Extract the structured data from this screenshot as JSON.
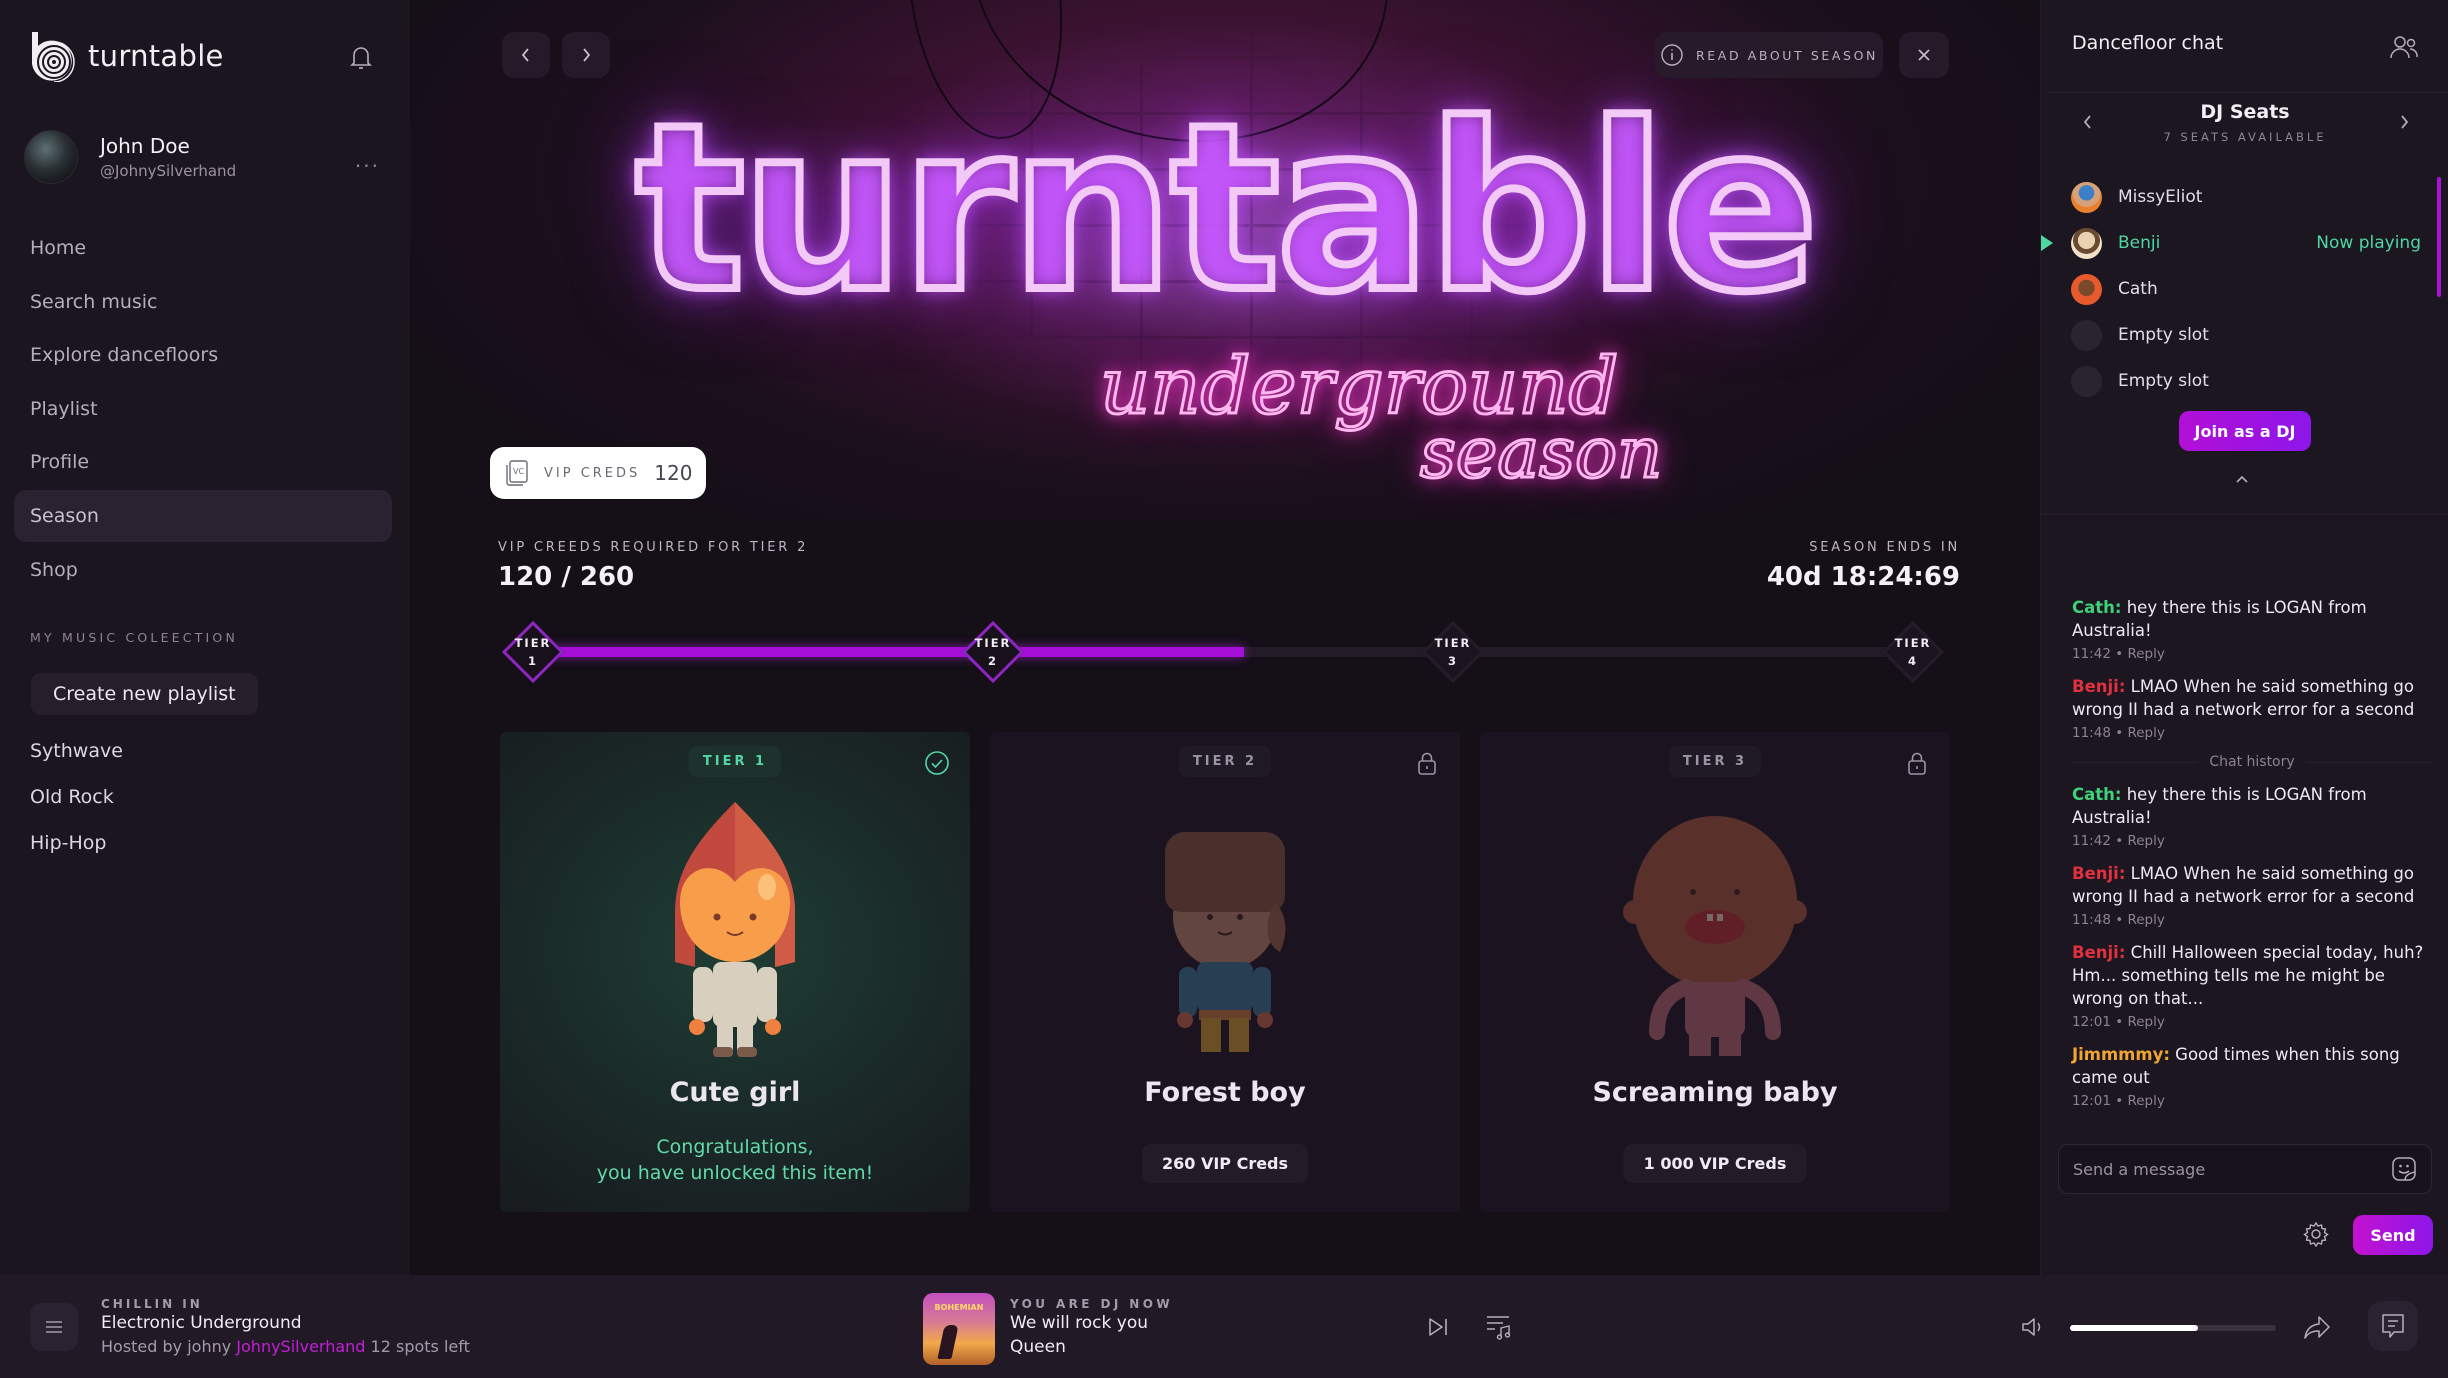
{
  "app": {
    "name": "turntable"
  },
  "user": {
    "name": "John Doe",
    "handle": "@JohnySilverhand",
    "more": "..."
  },
  "nav": {
    "items": [
      {
        "label": "Home",
        "active": false
      },
      {
        "label": "Search music",
        "active": false
      },
      {
        "label": "Explore dancefloors",
        "active": false
      },
      {
        "label": "Playlist",
        "active": false
      },
      {
        "label": "Profile",
        "active": false
      },
      {
        "label": "Season",
        "active": true
      },
      {
        "label": "Shop",
        "active": false
      }
    ]
  },
  "collection": {
    "title": "MY MUSIC COLEECTION",
    "create_label": "Create new playlist",
    "playlists": [
      "Sythwave",
      "Old Rock",
      "Hip-Hop"
    ]
  },
  "hero": {
    "title": "turntable",
    "subtitle_1": "underground",
    "subtitle_2": "season",
    "read_about": "READ ABOUT SEASON"
  },
  "vip": {
    "icon_text": "VC",
    "label": "VIP CREDS",
    "value": "120"
  },
  "progress": {
    "required_label": "VIP CREEDS REQUIRED FOR TIER 2",
    "required_value": "120 / 260",
    "ends_label": "SEASON ENDS IN",
    "ends_value": "40d 18:24:69",
    "fill_fraction": 0.515,
    "tiers": [
      {
        "line1": "TIER",
        "line2": "1",
        "reached": true
      },
      {
        "line1": "TIER",
        "line2": "2",
        "reached": true
      },
      {
        "line1": "TIER",
        "line2": "3",
        "reached": false
      },
      {
        "line1": "TIER",
        "line2": "4",
        "reached": false
      }
    ]
  },
  "cards": [
    {
      "tier": "TIER 1",
      "name": "Cute girl",
      "status": "unlocked",
      "congrats_1": "Congratulations,",
      "congrats_2": "you have unlocked this item!"
    },
    {
      "tier": "TIER 2",
      "name": "Forest boy",
      "status": "locked",
      "price": "260 VIP Creds"
    },
    {
      "tier": "TIER 3",
      "name": "Screaming baby",
      "status": "locked",
      "price": "1 000 VIP Creds"
    }
  ],
  "chat": {
    "title": "Dancefloor chat",
    "dj_title": "DJ Seats",
    "dj_sub": "7 SEATS AVAILABLE",
    "seats": [
      {
        "name": "MissyEliot",
        "state": ""
      },
      {
        "name": "Benji",
        "state": "Now playing"
      },
      {
        "name": "Cath",
        "state": ""
      },
      {
        "name": "Empty slot",
        "state": ""
      },
      {
        "name": "Empty slot",
        "state": ""
      }
    ],
    "join_label": "Join as a DJ",
    "history_label": "Chat history",
    "messages_recent": [
      {
        "who": "Cath:",
        "color": "#3fd17a",
        "text": " hey there this is LOGAN from Australia!",
        "time": "11:42",
        "reply": "Reply"
      },
      {
        "who": "Benji:",
        "color": "#e0323e",
        "text": " LMAO When he said something go wrong II had a network error for a second",
        "time": "11:48",
        "reply": "Reply"
      }
    ],
    "messages_history": [
      {
        "who": "Cath:",
        "color": "#3fd17a",
        "text": " hey there this is LOGAN from Australia!",
        "time": "11:42",
        "reply": "Reply"
      },
      {
        "who": "Benji:",
        "color": "#e0323e",
        "text": " LMAO When he said something go wrong II had a network error for a second",
        "time": "11:48",
        "reply": "Reply"
      },
      {
        "who": "Benji:",
        "color": "#e0323e",
        "text": " Chill Halloween special today, huh? Hm... something tells me he might be wrong on that...",
        "time": "12:01",
        "reply": "Reply"
      },
      {
        "who": "Jimmmmy:",
        "color": "#f0a530",
        "text": " Good times when this song came out",
        "time": "12:01",
        "reply": "Reply"
      }
    ],
    "input_placeholder": "Send a message",
    "send_label": "Send"
  },
  "player": {
    "chill_label": "CHILLIN IN",
    "room": "Electronic Underground",
    "host_prefix": "Hosted by johny ",
    "host_name": "JohnySilverhand",
    "spots": " 12 spots left",
    "dj_label": "YOU ARE DJ NOW",
    "song": "We will rock you",
    "artist": "Queen",
    "album_text": "BOHEMIAN",
    "volume_percent": 62
  },
  "colors": {
    "accent_purple": "#a50fd8",
    "accent_green": "#4fd7a0",
    "background": "#150f18"
  }
}
